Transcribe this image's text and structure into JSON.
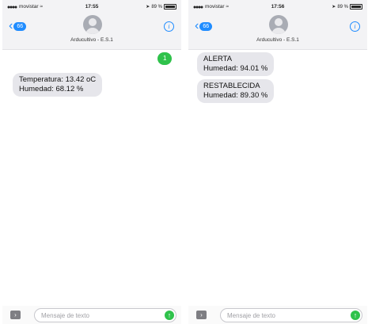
{
  "left_phone": {
    "status": {
      "carrier": "movistar",
      "time": "17:55",
      "battery": "89 %"
    },
    "nav": {
      "back_badge": "66",
      "contact_name": "Arducultivo - E.S.1"
    },
    "messages": [
      {
        "direction": "sent",
        "lines": [
          "1"
        ]
      },
      {
        "direction": "received",
        "lines": [
          "Temperatura: 13.42 oC",
          "Humedad: 68.12 %"
        ]
      }
    ],
    "composer": {
      "placeholder": "Mensaje de texto"
    }
  },
  "right_phone": {
    "status": {
      "carrier": "movistar",
      "time": "17:56",
      "battery": "89 %"
    },
    "nav": {
      "back_badge": "66",
      "contact_name": "Arducultivo - E.S.1"
    },
    "messages": [
      {
        "direction": "received",
        "lines": [
          "ALERTA",
          "Humedad: 94.01 %"
        ]
      },
      {
        "direction": "received",
        "lines": [
          "RESTABLECIDA",
          "Humedad: 89.30 %"
        ]
      }
    ],
    "composer": {
      "placeholder": "Mensaje de texto"
    }
  },
  "icons": {
    "back": "chevron-left-icon",
    "info": "info-icon",
    "apps": "apps-icon",
    "send": "send-arrow-icon",
    "signal": "signal-dots-icon",
    "wifi": "wifi-icon",
    "battery": "battery-icon",
    "avatar": "contact-avatar-icon"
  },
  "colors": {
    "accent_blue": "#1f8cff",
    "sent_green": "#2fc24b",
    "received_bubble": "#e6e6eb",
    "header_bg": "#f3f3f5"
  }
}
